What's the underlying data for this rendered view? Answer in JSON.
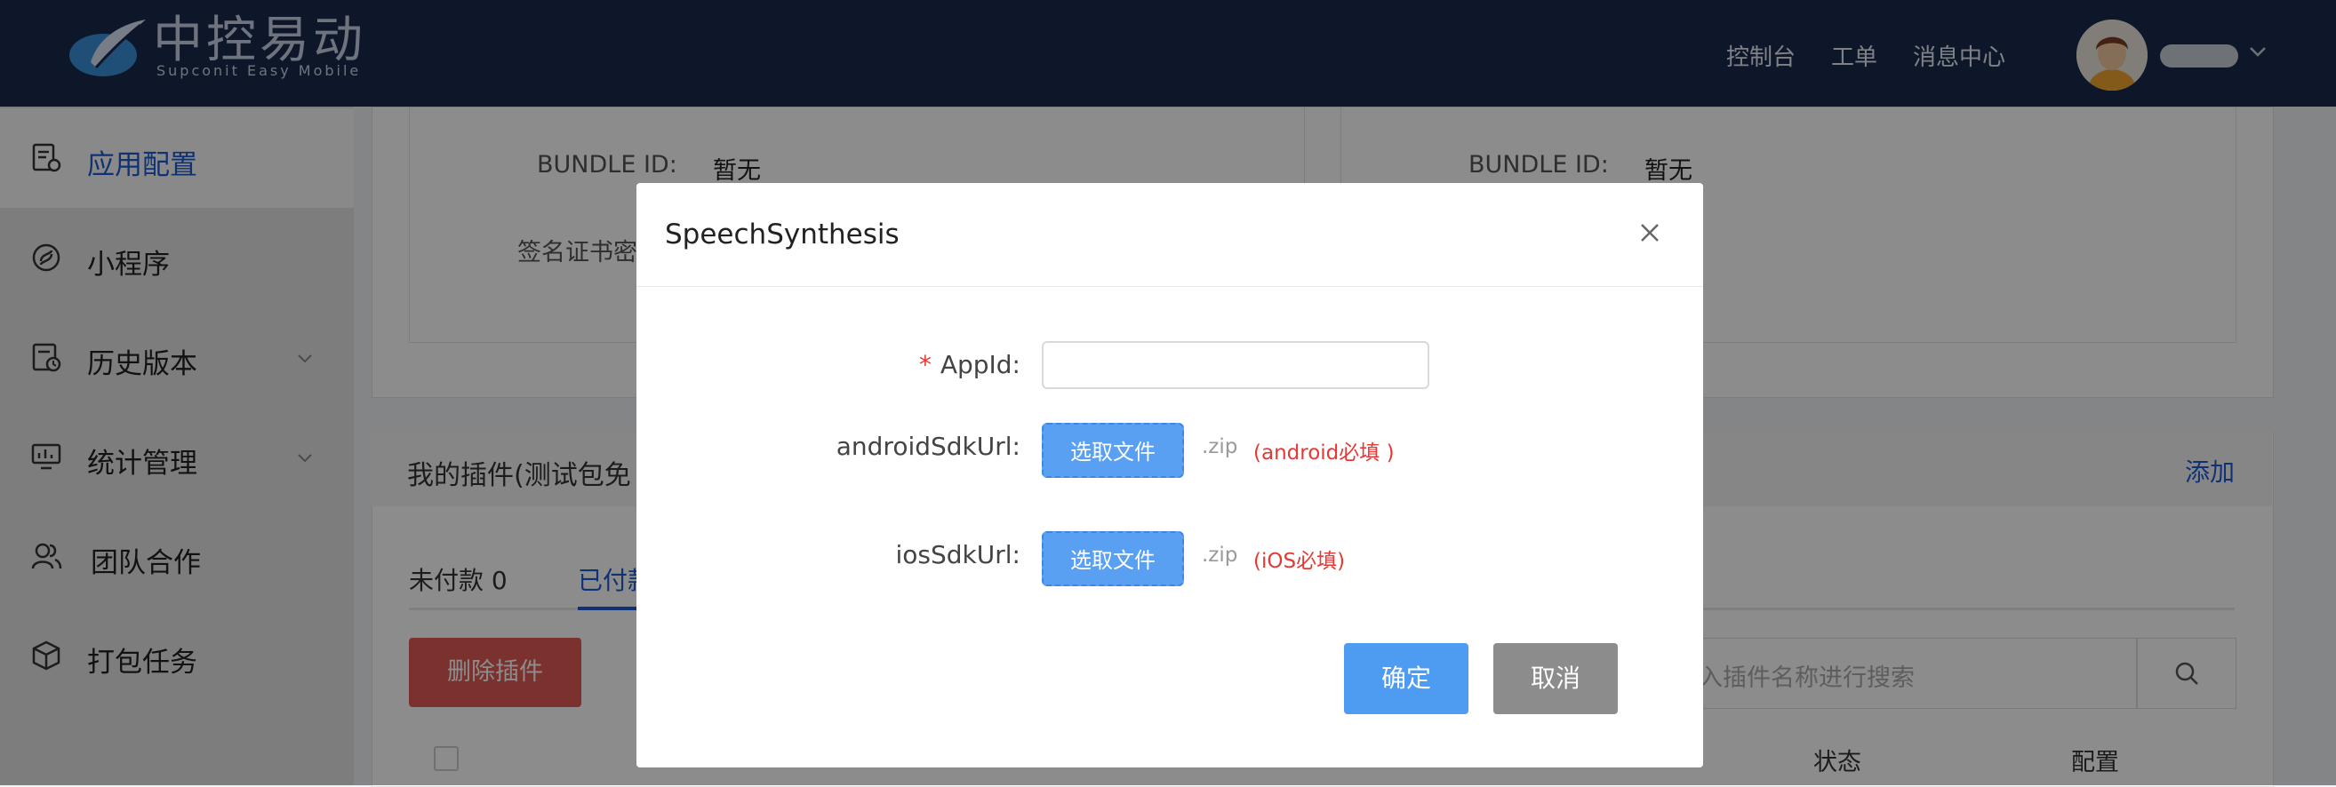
{
  "header": {
    "logo_text": "中控易动",
    "logo_sub": "Supconit Easy Mobile",
    "nav": [
      "控制台",
      "工单",
      "消息中心"
    ]
  },
  "sidebar": {
    "items": [
      {
        "label": "应用配置",
        "icon": "app-config-icon",
        "active": true
      },
      {
        "label": "小程序",
        "icon": "mini-program-icon"
      },
      {
        "label": "历史版本",
        "icon": "history-icon"
      },
      {
        "label": "统计管理",
        "icon": "statistics-icon"
      },
      {
        "label": "团队合作",
        "icon": "team-icon"
      },
      {
        "label": "打包任务",
        "icon": "package-icon"
      }
    ]
  },
  "main": {
    "bundle_label": "BUNDLE ID:",
    "bundle_value": "暂无",
    "cert_label": "签名证书密",
    "plugins_title": "我的插件(测试包免",
    "add_label": "添加",
    "tabs": [
      "未付款 0",
      "已付款"
    ],
    "delete_label": "删除插件",
    "search_placeholder": "入插件名称进行搜索",
    "columns": [
      "状态",
      "配置"
    ]
  },
  "modal": {
    "title": "SpeechSynthesis",
    "appid_label": "AppId:",
    "appid_value": "",
    "android_label": "androidSdkUrl:",
    "ios_label": "iosSdkUrl:",
    "upload_label": "选取文件",
    "ext": ".zip",
    "android_hint": "(android必填 )",
    "ios_hint": "(iOS必填)",
    "ok_label": "确定",
    "cancel_label": "取消"
  },
  "colors": {
    "header_bg": "#1b2a4e",
    "primary": "#4d9cf2",
    "danger": "#e53935"
  }
}
